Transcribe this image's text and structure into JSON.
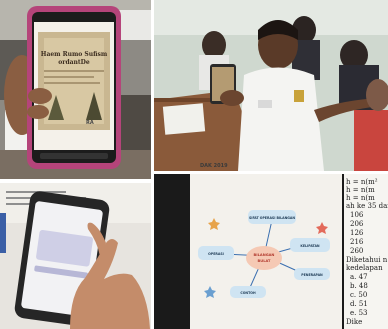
{
  "panels": [
    {
      "subject": "student-holding-phone-with-poem-card"
    },
    {
      "subject": "student-pointing-at-phone-in-classroom"
    },
    {
      "subject": "hand-tapping-phone-screen"
    },
    {
      "subject": "tablet-showing-mind-map"
    }
  ],
  "phone_card": {
    "title_line1": "Haem Rumo Sufism",
    "title_line2": "ordantDe",
    "watermark": "RA"
  },
  "desk_text": "DAK 2019",
  "mindmap": {
    "center_line1": "BILANGAN",
    "center_line2": "BULAT",
    "nodes": [
      "SIFAT OPERASI BILANGAN",
      "OPERASI",
      "KELIPATAN",
      "PENERAPAN",
      "CONTOH"
    ]
  },
  "worksheet_lines": [
    "h = n(m²",
    "h = n(m",
    "h = n(m",
    "ah ke 35 dar",
    "106",
    "206",
    "126",
    "216",
    "260",
    "Diketahui n",
    "kedelapan",
    "a. 47",
    "b. 48",
    "c. 50",
    "d. 51",
    "e. 53",
    "Dike"
  ],
  "colors": {
    "wall": "#cfd8cf",
    "uniform": "#f4f4f2",
    "desk": "#8a5a3a",
    "mindmap_bg": "#f3f1ec",
    "mindmap_center": "#f5c9b4",
    "mindmap_node": "#cfe4f2"
  }
}
